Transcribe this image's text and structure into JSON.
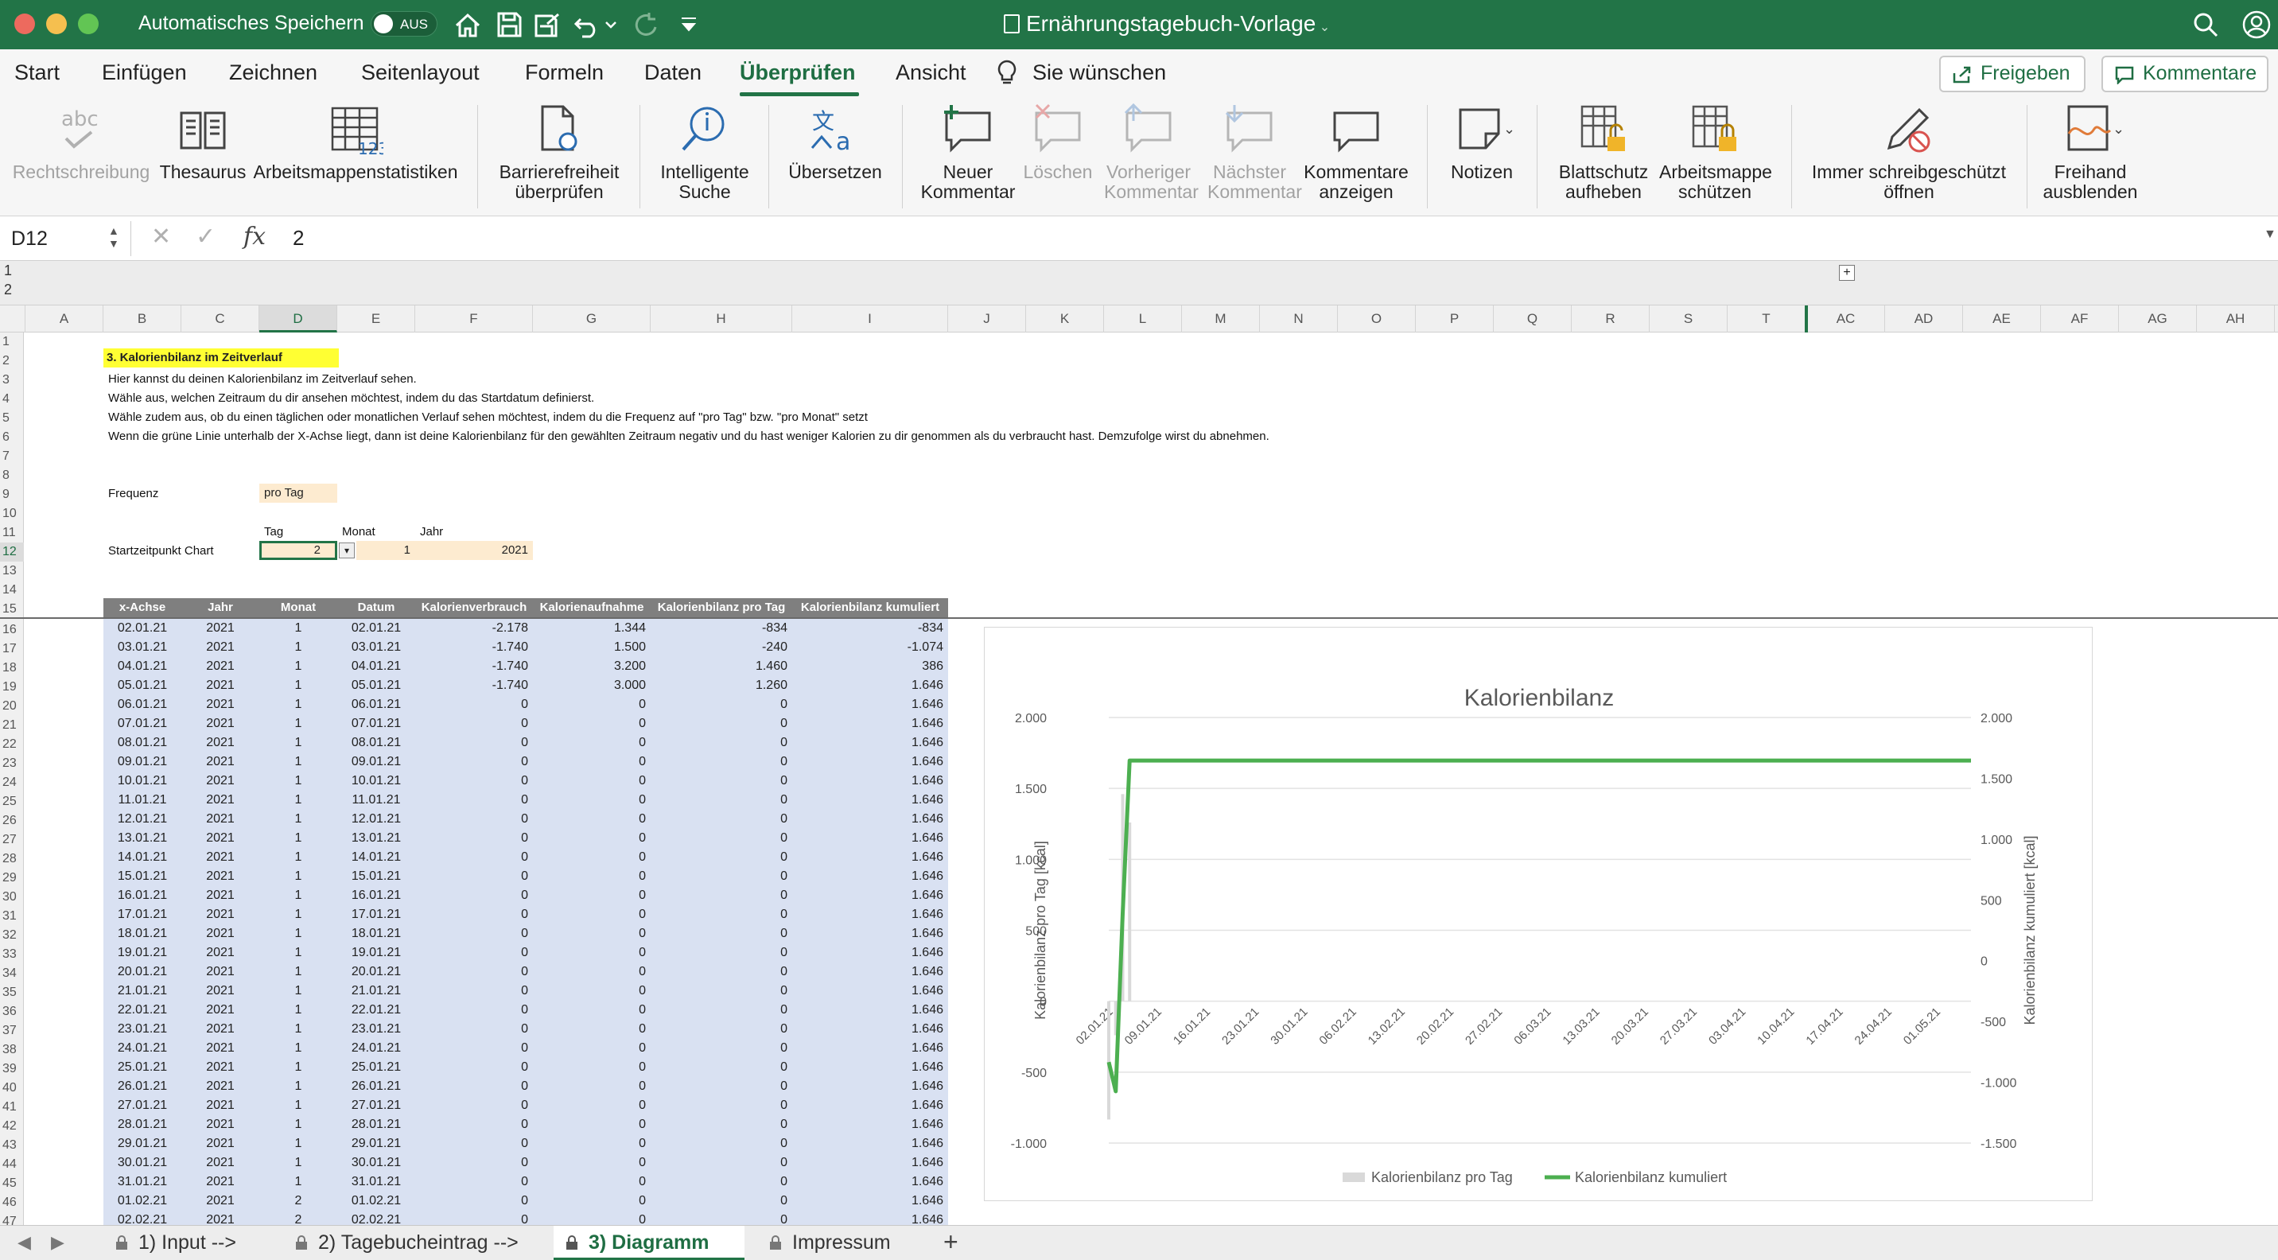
{
  "titlebar": {
    "autosave_label": "Automatisches Speichern",
    "autosave_state": "AUS",
    "doc_title": "Ernährungstagebuch-Vorlage",
    "colors": {
      "bar": "#227447",
      "close": "#ed6a5e",
      "min": "#f5bf4f",
      "max": "#62c554"
    }
  },
  "ribbon_tabs": {
    "items": [
      "Start",
      "Einfügen",
      "Zeichnen",
      "Seitenlayout",
      "Formeln",
      "Daten",
      "Überprüfen",
      "Ansicht"
    ],
    "tell_me": "Sie wünschen",
    "active": "Überprüfen",
    "share": "Freigeben",
    "comments": "Kommentare"
  },
  "ribbon": {
    "spelling_top": "abc",
    "spelling": "Rechtschreibung",
    "thesaurus": "Thesaurus",
    "stats": "Arbeitsmappenstatistiken",
    "access_1": "Barrierefreiheit",
    "access_2": "überprüfen",
    "smart_1": "Intelligente",
    "smart_2": "Suche",
    "translate": "Übersetzen",
    "newc_1": "Neuer",
    "newc_2": "Kommentar",
    "delete": "Löschen",
    "prev_1": "Vorheriger",
    "prev_2": "Kommentar",
    "next_1": "Nächster",
    "next_2": "Kommentar",
    "show_1": "Kommentare",
    "show_2": "anzeigen",
    "notes": "Notizen",
    "unprot_1": "Blattschutz",
    "unprot_2": "aufheben",
    "protwb_1": "Arbeitsmappe",
    "protwb_2": "schützen",
    "ro_1": "Immer schreibgeschützt",
    "ro_2": "öffnen",
    "ink_1": "Freihand",
    "ink_2": "ausblenden"
  },
  "formula_bar": {
    "cell": "D12",
    "fx": "fx",
    "value": "2"
  },
  "outline": {
    "level1": "1",
    "level2": "2",
    "expand": "+"
  },
  "columns": [
    "A",
    "B",
    "C",
    "D",
    "E",
    "F",
    "G",
    "H",
    "I",
    "J",
    "K",
    "L",
    "M",
    "N",
    "O",
    "P",
    "Q",
    "R",
    "S",
    "T",
    "AC",
    "AD",
    "AE",
    "AF",
    "AG",
    "AH"
  ],
  "rows": [
    "1",
    "2",
    "3",
    "4",
    "5",
    "6",
    "7",
    "8",
    "9",
    "10",
    "11",
    "12",
    "13",
    "14",
    "15",
    "16",
    "17",
    "18",
    "19",
    "20",
    "21",
    "22",
    "23",
    "24",
    "25",
    "26",
    "27",
    "28",
    "29",
    "30",
    "31",
    "32",
    "33",
    "34",
    "35",
    "36",
    "37",
    "38",
    "39",
    "40",
    "41",
    "42",
    "43",
    "44",
    "45",
    "46",
    "47"
  ],
  "sheet": {
    "heading": "3. Kalorienbilanz im Zeitverlauf",
    "line3": "Hier kannst du deinen Kalorienbilanz im Zeitverlauf sehen.",
    "line4": "Wähle aus, welchen Zeitraum du dir ansehen möchtest, indem du das Startdatum definierst.",
    "line5": "Wähle zudem aus, ob du einen täglichen oder monatlichen Verlauf sehen möchtest, indem du die Frequenz auf \"pro Tag\" bzw. \"pro Monat\" setzt",
    "line6": "Wenn die grüne Linie unterhalb der X-Achse liegt, dann ist deine Kalorienbilanz für den gewählten Zeitraum negativ und du hast weniger Kalorien zu dir genommen als du verbraucht hast. Demzufolge wirst du abnehmen.",
    "freq_label": "Frequenz",
    "freq_value": "pro Tag",
    "tag_label": "Tag",
    "monat_label": "Monat",
    "jahr_label": "Jahr",
    "start_label": "Startzeitpunkt Chart",
    "start_day": "2",
    "start_month": "1",
    "start_year": "2021",
    "dropdown": "▾"
  },
  "table": {
    "headers": [
      "x-Achse",
      "Jahr",
      "Monat",
      "Datum",
      "Kalorienverbrauch",
      "Kalorienaufnahme",
      "Kalorienbilanz pro Tag",
      "Kalorienbilanz kumuliert"
    ],
    "rows": [
      [
        "02.01.21",
        "2021",
        "1",
        "02.01.21",
        "-2.178",
        "1.344",
        "-834",
        "-834"
      ],
      [
        "03.01.21",
        "2021",
        "1",
        "03.01.21",
        "-1.740",
        "1.500",
        "-240",
        "-1.074"
      ],
      [
        "04.01.21",
        "2021",
        "1",
        "04.01.21",
        "-1.740",
        "3.200",
        "1.460",
        "386"
      ],
      [
        "05.01.21",
        "2021",
        "1",
        "05.01.21",
        "-1.740",
        "3.000",
        "1.260",
        "1.646"
      ],
      [
        "06.01.21",
        "2021",
        "1",
        "06.01.21",
        "0",
        "0",
        "0",
        "1.646"
      ],
      [
        "07.01.21",
        "2021",
        "1",
        "07.01.21",
        "0",
        "0",
        "0",
        "1.646"
      ],
      [
        "08.01.21",
        "2021",
        "1",
        "08.01.21",
        "0",
        "0",
        "0",
        "1.646"
      ],
      [
        "09.01.21",
        "2021",
        "1",
        "09.01.21",
        "0",
        "0",
        "0",
        "1.646"
      ],
      [
        "10.01.21",
        "2021",
        "1",
        "10.01.21",
        "0",
        "0",
        "0",
        "1.646"
      ],
      [
        "11.01.21",
        "2021",
        "1",
        "11.01.21",
        "0",
        "0",
        "0",
        "1.646"
      ],
      [
        "12.01.21",
        "2021",
        "1",
        "12.01.21",
        "0",
        "0",
        "0",
        "1.646"
      ],
      [
        "13.01.21",
        "2021",
        "1",
        "13.01.21",
        "0",
        "0",
        "0",
        "1.646"
      ],
      [
        "14.01.21",
        "2021",
        "1",
        "14.01.21",
        "0",
        "0",
        "0",
        "1.646"
      ],
      [
        "15.01.21",
        "2021",
        "1",
        "15.01.21",
        "0",
        "0",
        "0",
        "1.646"
      ],
      [
        "16.01.21",
        "2021",
        "1",
        "16.01.21",
        "0",
        "0",
        "0",
        "1.646"
      ],
      [
        "17.01.21",
        "2021",
        "1",
        "17.01.21",
        "0",
        "0",
        "0",
        "1.646"
      ],
      [
        "18.01.21",
        "2021",
        "1",
        "18.01.21",
        "0",
        "0",
        "0",
        "1.646"
      ],
      [
        "19.01.21",
        "2021",
        "1",
        "19.01.21",
        "0",
        "0",
        "0",
        "1.646"
      ],
      [
        "20.01.21",
        "2021",
        "1",
        "20.01.21",
        "0",
        "0",
        "0",
        "1.646"
      ],
      [
        "21.01.21",
        "2021",
        "1",
        "21.01.21",
        "0",
        "0",
        "0",
        "1.646"
      ],
      [
        "22.01.21",
        "2021",
        "1",
        "22.01.21",
        "0",
        "0",
        "0",
        "1.646"
      ],
      [
        "23.01.21",
        "2021",
        "1",
        "23.01.21",
        "0",
        "0",
        "0",
        "1.646"
      ],
      [
        "24.01.21",
        "2021",
        "1",
        "24.01.21",
        "0",
        "0",
        "0",
        "1.646"
      ],
      [
        "25.01.21",
        "2021",
        "1",
        "25.01.21",
        "0",
        "0",
        "0",
        "1.646"
      ],
      [
        "26.01.21",
        "2021",
        "1",
        "26.01.21",
        "0",
        "0",
        "0",
        "1.646"
      ],
      [
        "27.01.21",
        "2021",
        "1",
        "27.01.21",
        "0",
        "0",
        "0",
        "1.646"
      ],
      [
        "28.01.21",
        "2021",
        "1",
        "28.01.21",
        "0",
        "0",
        "0",
        "1.646"
      ],
      [
        "29.01.21",
        "2021",
        "1",
        "29.01.21",
        "0",
        "0",
        "0",
        "1.646"
      ],
      [
        "30.01.21",
        "2021",
        "1",
        "30.01.21",
        "0",
        "0",
        "0",
        "1.646"
      ],
      [
        "31.01.21",
        "2021",
        "1",
        "31.01.21",
        "0",
        "0",
        "0",
        "1.646"
      ],
      [
        "01.02.21",
        "2021",
        "2",
        "01.02.21",
        "0",
        "0",
        "0",
        "1.646"
      ],
      [
        "02.02.21",
        "2021",
        "2",
        "02.02.21",
        "0",
        "0",
        "0",
        "1.646"
      ]
    ]
  },
  "chart_data": {
    "type": "bar",
    "title": "Kalorienbilanz",
    "ylabel": "Kalorienbilanz pro Tag [kcal]",
    "y2label": "Kalorienbilanz kumuliert [kcal]",
    "ylim": [
      -1000,
      2000
    ],
    "y_ticks": [
      "2.000",
      "1.500",
      "1.000",
      "500",
      "0",
      "-500",
      "-1.000"
    ],
    "y2lim": [
      -1500,
      2000
    ],
    "y2_ticks": [
      "2.000",
      "1.500",
      "1.000",
      "500",
      "0",
      "-500",
      "-1.000",
      "-1.500"
    ],
    "x_ticks": [
      "02.01.21",
      "09.01.21",
      "16.01.21",
      "23.01.21",
      "30.01.21",
      "06.02.21",
      "13.02.21",
      "20.02.21",
      "27.02.21",
      "06.03.21",
      "13.03.21",
      "20.03.21",
      "27.03.21",
      "03.04.21",
      "10.04.21",
      "17.04.21",
      "24.04.21",
      "01.05.21"
    ],
    "x_start": "02.01.21",
    "x_end": "06.05.21",
    "series": [
      {
        "name": "Kalorienbilanz pro Tag",
        "kind": "bar",
        "axis": "left",
        "color": "#d9d9d9",
        "values": [
          -834,
          -240,
          1460,
          1260
        ]
      },
      {
        "name": "Kalorienbilanz kumuliert",
        "kind": "line",
        "axis": "right",
        "color": "#4caf50",
        "values": [
          -834,
          -1074,
          386,
          1646,
          1646
        ]
      }
    ],
    "legend": "bottom",
    "grid": true
  },
  "sheet_tabs": {
    "items": [
      "1) Input -->",
      "2) Tagebucheintrag -->",
      "3) Diagramm",
      "Impressum"
    ],
    "active": "3) Diagramm",
    "add": "+",
    "prev": "◀",
    "next": "▶"
  }
}
